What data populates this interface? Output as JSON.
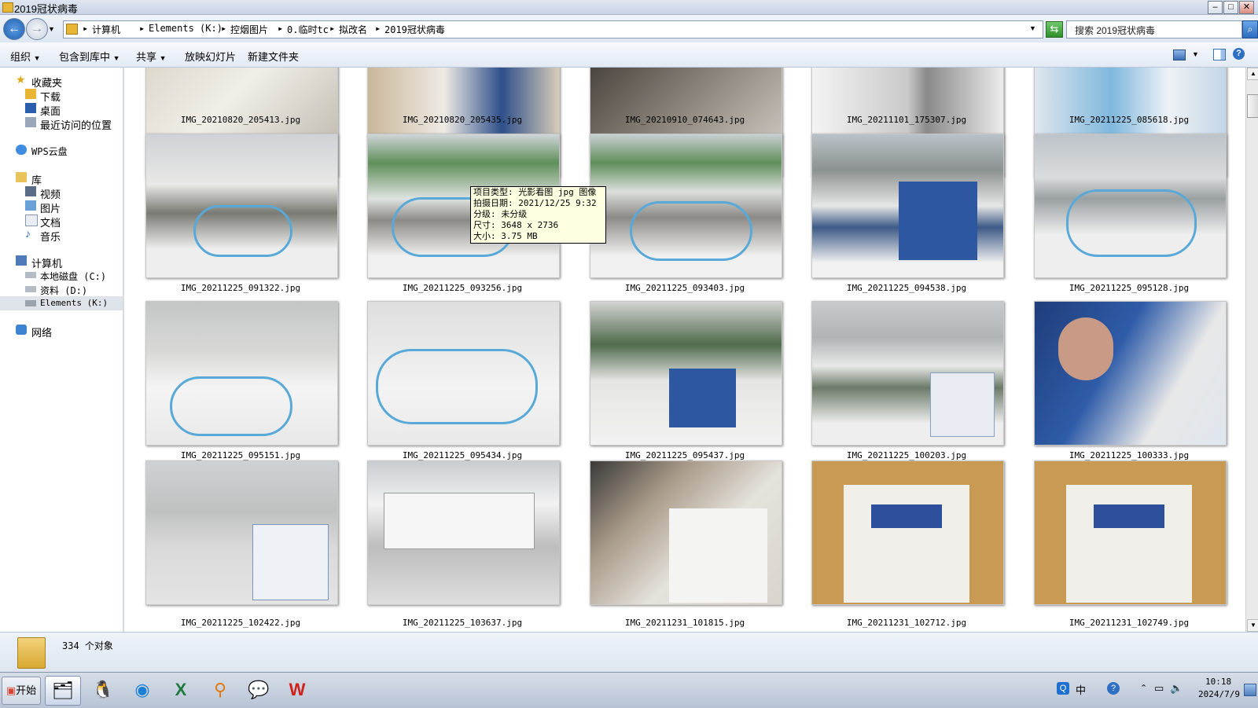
{
  "window": {
    "title": "2019冠状病毒"
  },
  "address": {
    "crumbs": [
      "计算机",
      "Elements (K:)",
      "控烟图片",
      "0.临时tc",
      "拟改名",
      "2019冠状病毒"
    ],
    "search_placeholder": "搜索 2019冠状病毒"
  },
  "toolbar": {
    "organize": "组织",
    "include_library": "包含到库中",
    "share": "共享",
    "slideshow": "放映幻灯片",
    "new_folder": "新建文件夹"
  },
  "nav": {
    "favorites": "收藏夹",
    "downloads": "下载",
    "desktop": "桌面",
    "recent": "最近访问的位置",
    "wps_cloud": "WPS云盘",
    "libraries": "库",
    "videos": "视频",
    "pictures": "图片",
    "documents": "文档",
    "music": "音乐",
    "computer": "计算机",
    "local_disk": "本地磁盘 (C:)",
    "data_disk": "资料 (D:)",
    "elements": "Elements (K:)",
    "network": "网络"
  },
  "files": [
    [
      "IMG_20210820_205413.jpg",
      "IMG_20210820_205435.jpg",
      "IMG_20210910_074643.jpg",
      "IMG_20211101_175307.jpg",
      "IMG_20211225_085618.jpg"
    ],
    [
      "IMG_20211225_091322.jpg",
      "IMG_20211225_093256.jpg",
      "IMG_20211225_093403.jpg",
      "IMG_20211225_094538.jpg",
      "IMG_20211225_095128.jpg"
    ],
    [
      "IMG_20211225_095151.jpg",
      "IMG_20211225_095434.jpg",
      "IMG_20211225_095437.jpg",
      "IMG_20211225_100203.jpg",
      "IMG_20211225_100333.jpg"
    ],
    [
      "IMG_20211225_102422.jpg",
      "IMG_20211225_103637.jpg",
      "IMG_20211231_101815.jpg",
      "IMG_20211231_102712.jpg",
      "IMG_20211231_102749.jpg"
    ]
  ],
  "tooltip": {
    "type": "项目类型: 光影看图 jpg 图像",
    "date": "拍摄日期: 2021/12/25 9:32",
    "rating": "分级: 未分级",
    "size": "尺寸: 3648 x 2736",
    "filesize": "大小: 3.75 MB"
  },
  "status": {
    "count": "334 个对象"
  },
  "taskbar": {
    "start": "开始",
    "time": "10:18",
    "date": "2024/7/9",
    "ime": "中"
  },
  "colors": {
    "accent": "#2a6bc4",
    "snow": "#e6e8ec",
    "bike_blue": "#59a9d8"
  }
}
